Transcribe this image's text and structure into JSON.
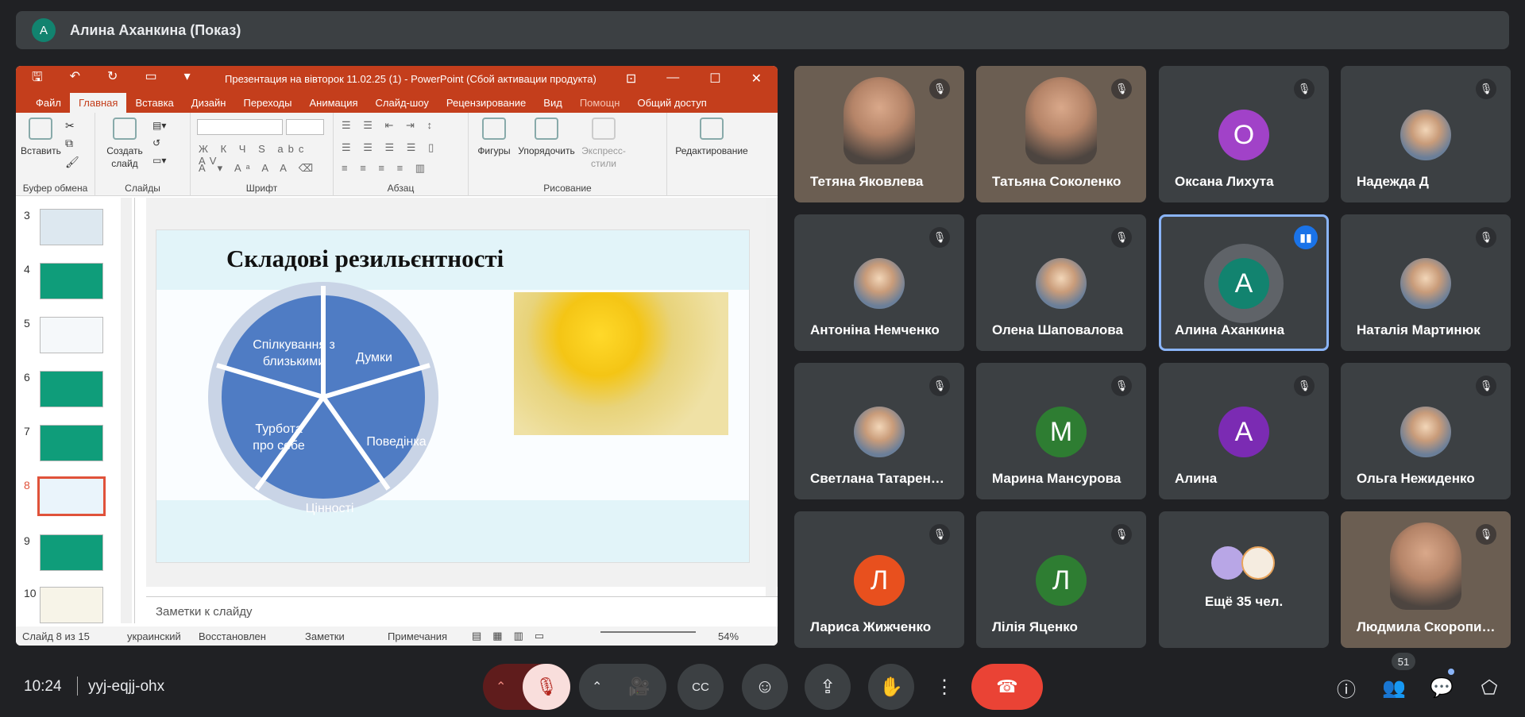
{
  "topbar": {
    "avatar_letter": "А",
    "title": "Алина Аханкина (Показ)"
  },
  "ppt": {
    "doc_title": "Презентация на вівторок 11.02.25 (1) - PowerPoint (Сбой активации продукта)",
    "tabs": [
      "Файл",
      "Главная",
      "Вставка",
      "Дизайн",
      "Переходы",
      "Анимация",
      "Слайд-шоу",
      "Рецензирование",
      "Вид",
      "Помощн",
      "Общий доступ"
    ],
    "ribbon": {
      "paste": "Вставить",
      "new_slide": "Создать слайд",
      "shapes": "Фигуры",
      "arrange": "Упорядочить",
      "quick_styles": "Экспресс-стили",
      "editing": "Редактирование",
      "groups": [
        "Буфер обмена",
        "Слайды",
        "Шрифт",
        "Абзац",
        "Рисование"
      ]
    },
    "thumbs": [
      {
        "n": "3"
      },
      {
        "n": "4"
      },
      {
        "n": "5"
      },
      {
        "n": "6"
      },
      {
        "n": "7"
      },
      {
        "n": "8"
      },
      {
        "n": "9"
      },
      {
        "n": "10"
      }
    ],
    "slide": {
      "title": "Складові резильєнтності",
      "segments": [
        "Спілкування з близькими",
        "Думки",
        "Поведінка",
        "Цінності",
        "Турбота про себе"
      ]
    },
    "notes_placeholder": "Заметки к слайду",
    "status": {
      "slide_of": "Слайд 8 из 15",
      "language": "украинский",
      "restored": "Восстановлен",
      "notes": "Заметки",
      "comments": "Примечания",
      "zoom": "54%"
    }
  },
  "participants": [
    {
      "name": "Тетяна Яковлева",
      "type": "video"
    },
    {
      "name": "Татьяна Соколенко",
      "type": "video"
    },
    {
      "name": "Оксана Лихута",
      "type": "letter",
      "letter": "О",
      "color": "#a142c8"
    },
    {
      "name": "Надежда Д",
      "type": "photo"
    },
    {
      "name": "Антоніна Немченко",
      "type": "photo"
    },
    {
      "name": "Олена Шаповалова",
      "type": "photo"
    },
    {
      "name": "Алина Аханкина",
      "type": "letter",
      "letter": "А",
      "color": "#12836f",
      "active": true
    },
    {
      "name": "Наталія Мартинюк",
      "type": "photo"
    },
    {
      "name": "Светлана Татарен…",
      "type": "photo"
    },
    {
      "name": "Марина Мансурова",
      "type": "letter",
      "letter": "М",
      "color": "#2e7d32"
    },
    {
      "name": "Алина",
      "type": "letter",
      "letter": "А",
      "color": "#7b2bb3"
    },
    {
      "name": "Ольга Нежиденко",
      "type": "photo"
    },
    {
      "name": "Лариса Жижченко",
      "type": "letter",
      "letter": "Л",
      "color": "#e8501e"
    },
    {
      "name": "Лілія Яценко",
      "type": "letter",
      "letter": "Л",
      "color": "#2e7d32"
    },
    {
      "name": "Ещё 35 чел.",
      "type": "more"
    },
    {
      "name": "Людмила Скоропи…",
      "type": "video"
    }
  ],
  "bottombar": {
    "time": "10:24",
    "meeting_code": "yyj-eqjj-ohx",
    "participants_count": "51"
  }
}
